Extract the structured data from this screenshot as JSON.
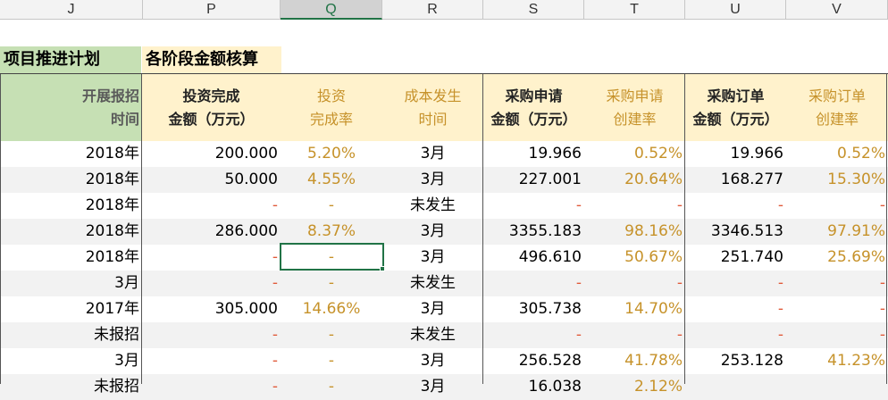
{
  "column_headers": [
    "J",
    "P",
    "Q",
    "R",
    "S",
    "T",
    "U",
    "V"
  ],
  "selected_column": "Q",
  "titles": {
    "left": "项目推进计划",
    "right": "各阶段金额核算"
  },
  "headers": {
    "c1": [
      "开展报招",
      "时间"
    ],
    "c2": [
      "投资完成",
      "金额（万元）"
    ],
    "c3": [
      "投资",
      "完成率"
    ],
    "c4": [
      "成本发生",
      "时间"
    ],
    "c5": [
      "采购申请",
      "金额（万元）"
    ],
    "c6": [
      "采购申请",
      "创建率"
    ],
    "c7": [
      "采购订单",
      "金额（万元）"
    ],
    "c8": [
      "采购订单",
      "创建率"
    ]
  },
  "rows": [
    [
      "2018年",
      "200.000",
      "5.20%",
      "3月",
      "19.966",
      "0.52%",
      "19.966",
      "0.52%"
    ],
    [
      "2018年",
      "50.000",
      "4.55%",
      "3月",
      "227.001",
      "20.64%",
      "168.277",
      "15.30%"
    ],
    [
      "2018年",
      "-",
      "-",
      "未发生",
      "-",
      "-",
      "-",
      "-"
    ],
    [
      "2018年",
      "286.000",
      "8.37%",
      "3月",
      "3355.183",
      "98.16%",
      "3346.513",
      "97.91%"
    ],
    [
      "2018年",
      "-",
      "-",
      "3月",
      "496.610",
      "50.67%",
      "251.740",
      "25.69%"
    ],
    [
      "3月",
      "-",
      "-",
      "未发生",
      "-",
      "-",
      "-",
      "-"
    ],
    [
      "2017年",
      "305.000",
      "14.66%",
      "3月",
      "305.738",
      "14.70%",
      "-",
      "-"
    ],
    [
      "未报招",
      "-",
      "-",
      "未发生",
      "-",
      "-",
      "-",
      "-"
    ],
    [
      "3月",
      "-",
      "-",
      "3月",
      "256.528",
      "41.78%",
      "253.128",
      "41.23%"
    ],
    [
      "未报招",
      "-",
      "-",
      "3月",
      "16.038",
      "2.12%",
      "",
      ""
    ]
  ],
  "colors": {
    "green_header": "#c6e0b4",
    "orange_header": "#fff2cc",
    "orange_text": "#c6922a",
    "red_dash": "#e05a3a",
    "selection": "#217346"
  }
}
